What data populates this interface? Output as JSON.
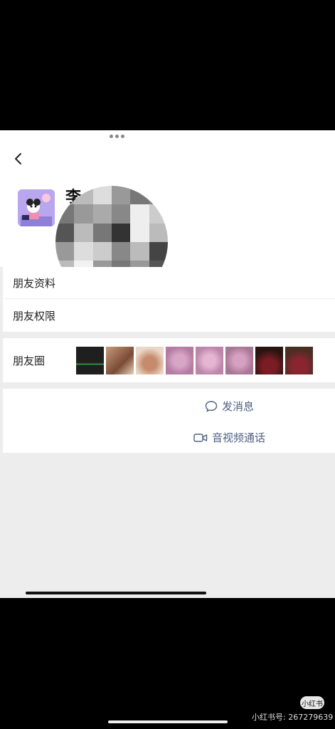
{
  "profile": {
    "name_partial": "李",
    "moments_label": "朋友圈"
  },
  "menu": {
    "friend_info": "朋友资料",
    "friend_permissions": "朋友权限"
  },
  "actions": {
    "send_message": "发消息",
    "video_call": "音视频通话"
  },
  "watermark": {
    "badge": "小红书",
    "id_text": "小红书号: 267279639"
  },
  "icons": {
    "back": "chevron-left-icon",
    "message": "chat-bubble-icon",
    "video": "video-camera-icon"
  },
  "colors": {
    "action_text": "#506080",
    "page_bg": "#ededed"
  }
}
